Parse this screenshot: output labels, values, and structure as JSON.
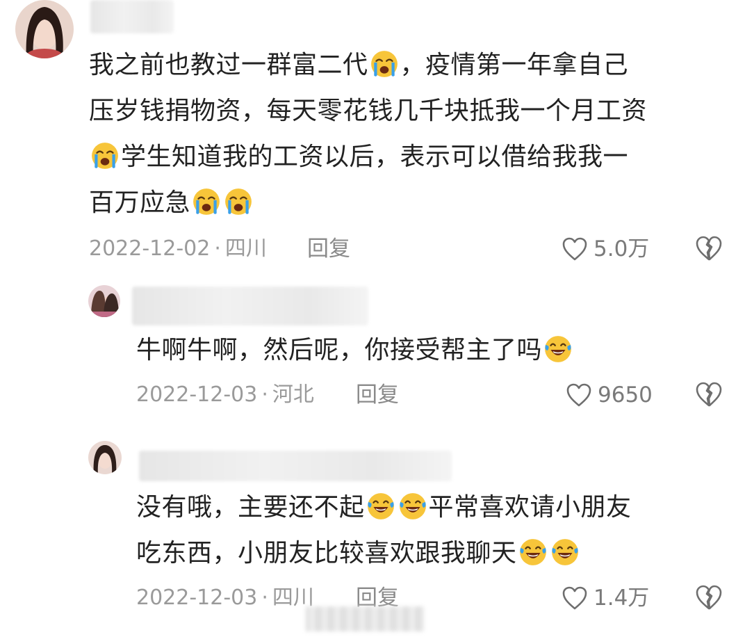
{
  "comments": [
    {
      "text_lines": [
        [
          "我之前也教过一群富二代",
          "[cry]",
          "，疫情第一年拿自己"
        ],
        [
          "压岁钱捐物资，每天零花钱几千块抵我一个月工资"
        ],
        [
          "[cry]",
          "学生知道我的工资以后，表示可以借给我我一"
        ],
        [
          "百万应急",
          "[cry]",
          "[cry]"
        ]
      ],
      "date": "2022-12-02",
      "location": "四川",
      "reply_label": "回复",
      "likes": "5.0万"
    },
    {
      "text_lines": [
        [
          "牛啊牛啊，然后呢，你接受帮主了吗",
          "[laugh]"
        ]
      ],
      "date": "2022-12-03",
      "location": "河北",
      "reply_label": "回复",
      "likes": "9650"
    },
    {
      "text_lines": [
        [
          "没有哦，主要还不起",
          "[laugh]",
          "[laugh]",
          "平常喜欢请小朋友"
        ],
        [
          "吃东西，小朋友比较喜欢跟我聊天",
          "[laugh]",
          "[laugh]"
        ]
      ],
      "date": "2022-12-03",
      "location": "四川",
      "reply_label": "回复",
      "likes": "1.4万"
    }
  ],
  "separator": "·",
  "icons": {
    "like": "heart-outline-icon",
    "dislike": "broken-heart-icon",
    "cry": "loudly-crying-face-emoji",
    "laugh": "tears-of-joy-emoji"
  },
  "colors": {
    "text": "#222222",
    "meta": "#9a9a9a",
    "emoji_yellow": "#f7c53a",
    "tear_blue": "#3aa0e8"
  }
}
